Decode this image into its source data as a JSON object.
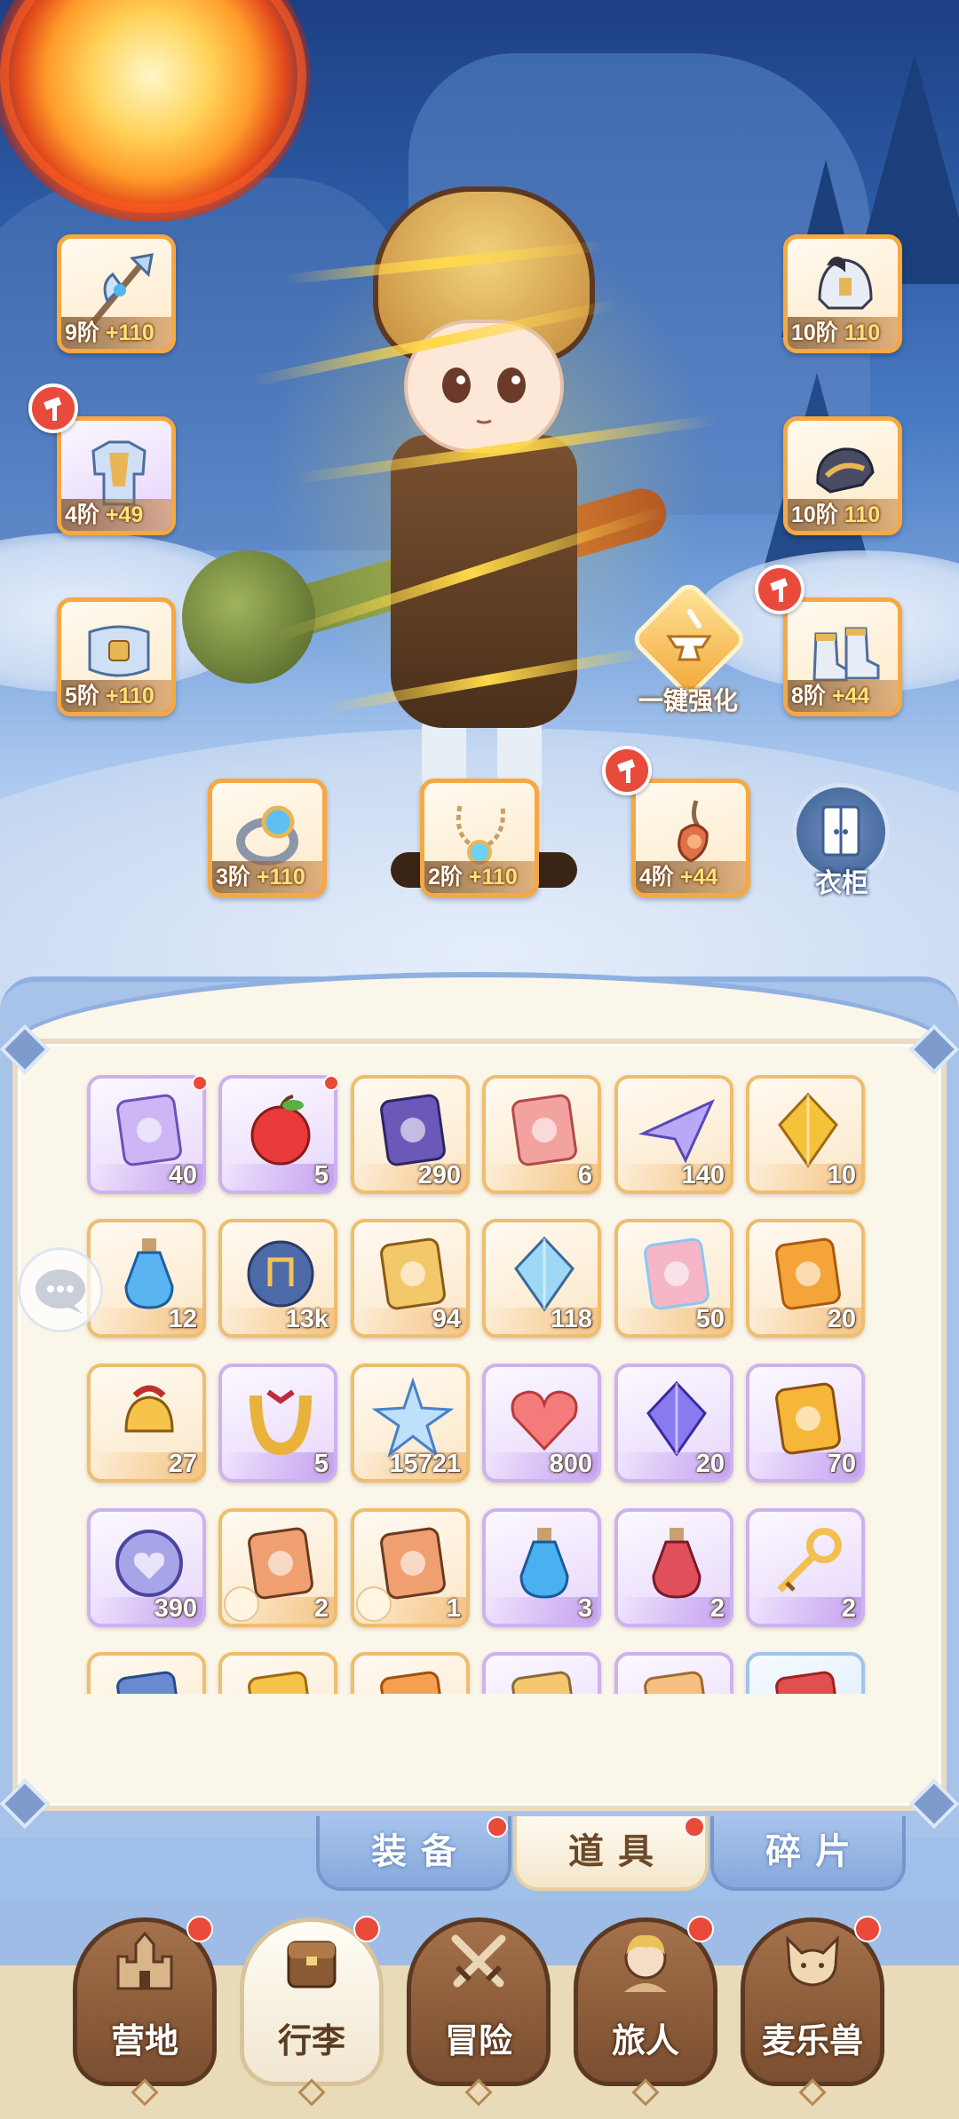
{
  "equipment": [
    {
      "slot": "weapon",
      "level": "9阶",
      "bonus": "+110",
      "icon": "axe-spear-icon",
      "frame": "orange",
      "hammer": false
    },
    {
      "slot": "armor",
      "level": "4阶",
      "bonus": "+49",
      "icon": "armor-icon",
      "frame": "purple",
      "hammer": true
    },
    {
      "slot": "belt",
      "level": "5阶",
      "bonus": "+110",
      "icon": "belt-icon",
      "frame": "orange",
      "hammer": false
    },
    {
      "slot": "helmet",
      "level": "10阶",
      "bonus": "110",
      "icon": "helmet-icon",
      "frame": "orange",
      "hammer": false
    },
    {
      "slot": "gloves",
      "level": "10阶",
      "bonus": "110",
      "icon": "gauntlet-icon",
      "frame": "orange",
      "hammer": false
    },
    {
      "slot": "boots",
      "level": "8阶",
      "bonus": "+44",
      "icon": "boots-icon",
      "frame": "orange",
      "hammer": true
    },
    {
      "slot": "ring",
      "level": "3阶",
      "bonus": "+110",
      "icon": "ring-icon",
      "frame": "orange",
      "hammer": false
    },
    {
      "slot": "necklace",
      "level": "2阶",
      "bonus": "+110",
      "icon": "necklace-icon",
      "frame": "orange",
      "hammer": false
    },
    {
      "slot": "amulet",
      "level": "4阶",
      "bonus": "+44",
      "icon": "amulet-icon",
      "frame": "orange",
      "hammer": true
    }
  ],
  "enhance_label": "一键强化",
  "wardrobe_label": "衣柜",
  "bag": {
    "items": [
      {
        "count": "40",
        "icon": "moon-card-icon",
        "rarity": "purple",
        "dot": true
      },
      {
        "count": "5",
        "icon": "apple-icon",
        "rarity": "purple",
        "dot": true
      },
      {
        "count": "290",
        "icon": "ticket-icon",
        "rarity": "orange",
        "dot": false
      },
      {
        "count": "6",
        "icon": "monster-card-icon",
        "rarity": "orange",
        "dot": false
      },
      {
        "count": "140",
        "icon": "paper-plane-icon",
        "rarity": "orange",
        "dot": false
      },
      {
        "count": "10",
        "icon": "gold-gem-icon",
        "rarity": "orange",
        "dot": false
      },
      {
        "count": "12",
        "icon": "blue-potion-icon",
        "rarity": "orange",
        "dot": false
      },
      {
        "count": "13k",
        "icon": "crystal-orb-icon",
        "rarity": "orange",
        "dot": false
      },
      {
        "count": "94",
        "icon": "lyre-icon",
        "rarity": "orange",
        "dot": false
      },
      {
        "count": "118",
        "icon": "ice-crystal-icon",
        "rarity": "orange",
        "dot": false
      },
      {
        "count": "50",
        "icon": "paint-tube-icon",
        "rarity": "orange",
        "dot": false
      },
      {
        "count": "20",
        "icon": "outfit-card-icon",
        "rarity": "orange",
        "dot": false
      },
      {
        "count": "27",
        "icon": "bell-icon",
        "rarity": "orange",
        "dot": false
      },
      {
        "count": "5",
        "icon": "horseshoe-icon",
        "rarity": "purple",
        "dot": false
      },
      {
        "count": "15721",
        "icon": "star-crystal-icon",
        "rarity": "orange",
        "dot": false
      },
      {
        "count": "800",
        "icon": "heart-icon",
        "rarity": "purple",
        "dot": false
      },
      {
        "count": "20",
        "icon": "purple-gem-icon",
        "rarity": "purple",
        "dot": false
      },
      {
        "count": "70",
        "icon": "amber-stone-icon",
        "rarity": "purple",
        "dot": false
      },
      {
        "count": "390",
        "icon": "coin-icon",
        "rarity": "purple",
        "dot": false
      },
      {
        "count": "2",
        "icon": "forge-stone-sword-icon",
        "rarity": "orange",
        "dot": false
      },
      {
        "count": "1",
        "icon": "forge-stone-boot-icon",
        "rarity": "orange",
        "dot": false
      },
      {
        "count": "3",
        "icon": "blue-bottle-icon",
        "rarity": "purple",
        "dot": false
      },
      {
        "count": "2",
        "icon": "red-flask-icon",
        "rarity": "purple",
        "dot": false
      },
      {
        "count": "2",
        "icon": "golden-key-icon",
        "rarity": "purple",
        "dot": false
      },
      {
        "count": "",
        "icon": "blue-card-icon",
        "rarity": "orange",
        "dot": false
      },
      {
        "count": "",
        "icon": "gold-item-icon",
        "rarity": "orange",
        "dot": false
      },
      {
        "count": "",
        "icon": "orange-item-icon",
        "rarity": "orange",
        "dot": false
      },
      {
        "count": "",
        "icon": "cat-item-icon",
        "rarity": "purple",
        "dot": false
      },
      {
        "count": "",
        "icon": "mask-item-icon",
        "rarity": "purple",
        "dot": false
      },
      {
        "count": "",
        "icon": "red-item-icon",
        "rarity": "blue",
        "dot": false
      }
    ]
  },
  "tabs": [
    {
      "label": "装备",
      "active": false,
      "dot": true
    },
    {
      "label": "道具",
      "active": true,
      "dot": true
    },
    {
      "label": "碎片",
      "active": false,
      "dot": false
    }
  ],
  "nav": [
    {
      "label": "营地",
      "icon": "castle-icon",
      "active": false,
      "dot": true
    },
    {
      "label": "行李",
      "icon": "backpack-icon",
      "active": true,
      "dot": true
    },
    {
      "label": "冒险",
      "icon": "crossed-swords-icon",
      "active": false,
      "dot": false
    },
    {
      "label": "旅人",
      "icon": "traveler-icon",
      "active": false,
      "dot": true
    },
    {
      "label": "麦乐兽",
      "icon": "cat-beast-icon",
      "active": false,
      "dot": true
    }
  ],
  "colors": {
    "accent_orange": "#f6a842",
    "rare_purple": "#cdb2f0",
    "notify_red": "#ea4a3a",
    "panel_cream": "#fbf6ea",
    "frame_blue": "#8fb0e0"
  }
}
